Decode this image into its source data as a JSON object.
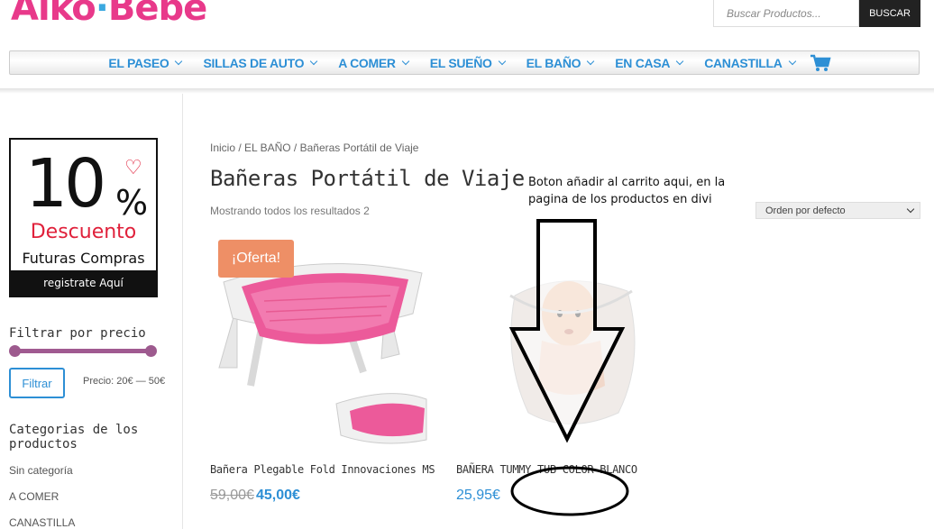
{
  "logo": {
    "text_a": "Aiko",
    "sep": "·",
    "text_b": "Bebé"
  },
  "search": {
    "placeholder": "Buscar Productos...",
    "button": "BUSCAR"
  },
  "nav": {
    "items": [
      {
        "label": "EL PASEO"
      },
      {
        "label": "SILLAS DE AUTO"
      },
      {
        "label": "A COMER"
      },
      {
        "label": "EL SUEÑO"
      },
      {
        "label": "EL BAÑO"
      },
      {
        "label": "EN CASA"
      },
      {
        "label": "CANASTILLA"
      }
    ],
    "cart_icon": "cart-icon"
  },
  "promo": {
    "percent": "10",
    "percent_sign": "%",
    "discount": "Descuento",
    "future": "Futuras Compras",
    "register": "registrate Aquí"
  },
  "price_filter": {
    "title": "Filtrar por precio",
    "button": "Filtrar",
    "range_label": "Precio: 20€ — 50€"
  },
  "categories": {
    "title_line1": "Categorias de los",
    "title_line2": "productos",
    "items": [
      "Sin categoría",
      "A COMER",
      "CANASTILLA"
    ]
  },
  "breadcrumb": "Inicio / EL BAÑO / Bañeras Portátil de Viaje",
  "page_title": "Bañeras Portátil de Viaje",
  "result_count": "Mostrando todos los resultados 2",
  "orderby": {
    "selected": "Orden por defecto"
  },
  "products": [
    {
      "name": "Bañera Plegable Fold Innovaciones MS",
      "badge": "¡Oferta!",
      "old_price": "59,00€",
      "price": "45,00€"
    },
    {
      "name": "BAÑERA TUMMY TUB COLOR BLANCO",
      "price": "25,95€"
    }
  ],
  "annotation": {
    "line1": "Boton añadir al carrito aqui, en la",
    "line2": "pagina de los productos en divi"
  },
  "colors": {
    "accent": "#2d8fd5",
    "sale_badge": "#ee8f66",
    "slider": "#9d5a8e",
    "promo_red": "#e0213b"
  }
}
